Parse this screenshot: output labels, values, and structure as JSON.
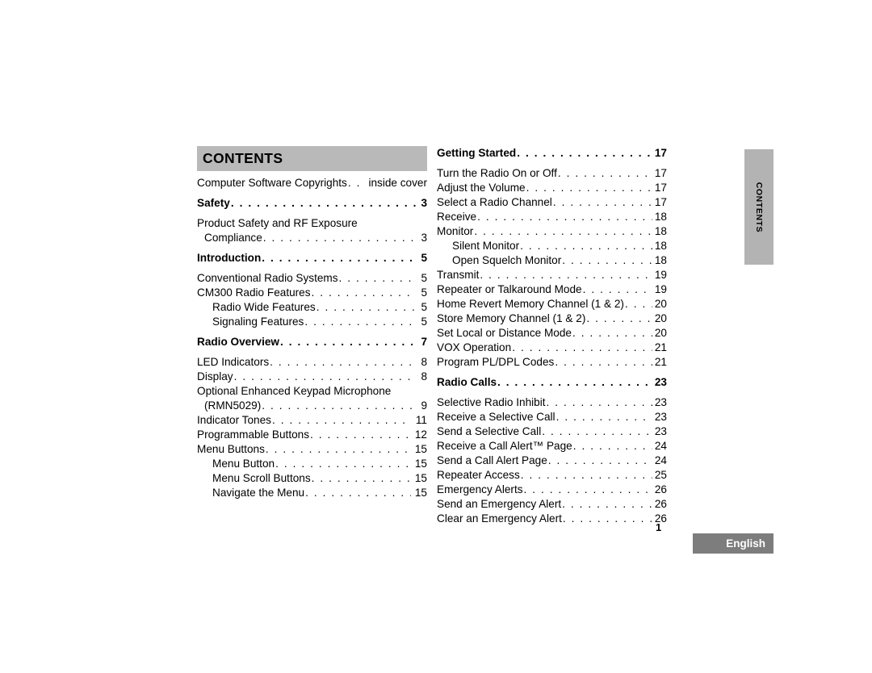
{
  "header": {
    "title": "CONTENTS"
  },
  "side_tab": {
    "label": "CONTENTS",
    "color": "#b3b3b3"
  },
  "footer": {
    "page_number": "1",
    "language_badge": "English",
    "badge_color": "#7d7d7d",
    "badge_text_color": "#ffffff"
  },
  "left_column": {
    "entries": [
      {
        "label": "Computer Software Copyrights",
        "page": "inside cover",
        "bold": false,
        "indent": 0,
        "leader": true
      },
      {
        "label": "Safety",
        "page": "3",
        "bold": true,
        "indent": 0,
        "leader": true,
        "gap_before": true,
        "gap_after": false
      },
      {
        "label": "Product Safety and RF Exposure",
        "page": "",
        "bold": false,
        "indent": 0,
        "leader": false
      },
      {
        "label": "Compliance",
        "page": "3",
        "bold": false,
        "indent": "cont",
        "leader": true
      },
      {
        "label": "Introduction",
        "page": "5",
        "bold": true,
        "indent": 0,
        "leader": true,
        "gap_before": true
      },
      {
        "label": "Conventional Radio Systems",
        "page": "5",
        "bold": false,
        "indent": 0,
        "leader": true
      },
      {
        "label": "CM300 Radio Features",
        "page": "5",
        "bold": false,
        "indent": 0,
        "leader": true
      },
      {
        "label": "Radio Wide Features",
        "page": "5",
        "bold": false,
        "indent": 1,
        "leader": true
      },
      {
        "label": "Signaling Features",
        "page": "5",
        "bold": false,
        "indent": 1,
        "leader": true
      },
      {
        "label": "Radio Overview",
        "page": "7",
        "bold": true,
        "indent": 0,
        "leader": true,
        "gap_before": true
      },
      {
        "label": "LED Indicators",
        "page": "8",
        "bold": false,
        "indent": 0,
        "leader": true
      },
      {
        "label": "Display",
        "page": "8",
        "bold": false,
        "indent": 0,
        "leader": true
      },
      {
        "label": "Optional Enhanced Keypad Microphone",
        "page": "",
        "bold": false,
        "indent": 0,
        "leader": false
      },
      {
        "label": "(RMN5029)",
        "page": "9",
        "bold": false,
        "indent": "cont",
        "leader": true
      },
      {
        "label": "Indicator Tones",
        "page": "11",
        "bold": false,
        "indent": 0,
        "leader": true
      },
      {
        "label": "Programmable Buttons",
        "page": "12",
        "bold": false,
        "indent": 0,
        "leader": true
      },
      {
        "label": "Menu Buttons",
        "page": "15",
        "bold": false,
        "indent": 0,
        "leader": true
      },
      {
        "label": "Menu Button",
        "page": "15",
        "bold": false,
        "indent": 1,
        "leader": true
      },
      {
        "label": "Menu Scroll Buttons",
        "page": "15",
        "bold": false,
        "indent": 1,
        "leader": true
      },
      {
        "label": "Navigate the Menu",
        "page": "15",
        "bold": false,
        "indent": 1,
        "leader": true
      }
    ]
  },
  "right_column": {
    "entries": [
      {
        "label": "Getting Started",
        "page": "17",
        "bold": true,
        "indent": 0,
        "leader": true
      },
      {
        "label": "Turn the Radio On or Off",
        "page": "17",
        "bold": false,
        "indent": 0,
        "leader": true
      },
      {
        "label": "Adjust the Volume",
        "page": "17",
        "bold": false,
        "indent": 0,
        "leader": true
      },
      {
        "label": "Select a Radio Channel",
        "page": "17",
        "bold": false,
        "indent": 0,
        "leader": true
      },
      {
        "label": "Receive",
        "page": "18",
        "bold": false,
        "indent": 0,
        "leader": true
      },
      {
        "label": "Monitor",
        "page": "18",
        "bold": false,
        "indent": 0,
        "leader": true
      },
      {
        "label": "Silent Monitor",
        "page": "18",
        "bold": false,
        "indent": 1,
        "leader": true
      },
      {
        "label": "Open Squelch Monitor",
        "page": "18",
        "bold": false,
        "indent": 1,
        "leader": true
      },
      {
        "label": "Transmit",
        "page": "19",
        "bold": false,
        "indent": 0,
        "leader": true
      },
      {
        "label": "Repeater or Talkaround Mode",
        "page": "19",
        "bold": false,
        "indent": 0,
        "leader": true
      },
      {
        "label": "Home Revert Memory Channel (1 & 2)",
        "page": "20",
        "bold": false,
        "indent": 0,
        "leader": true
      },
      {
        "label": "Store Memory Channel (1 & 2)",
        "page": "20",
        "bold": false,
        "indent": 0,
        "leader": true
      },
      {
        "label": "Set Local or Distance Mode",
        "page": "20",
        "bold": false,
        "indent": 0,
        "leader": true
      },
      {
        "label": "VOX Operation",
        "page": "21",
        "bold": false,
        "indent": 0,
        "leader": true
      },
      {
        "label": "Program PL/DPL Codes",
        "page": "21",
        "bold": false,
        "indent": 0,
        "leader": true
      },
      {
        "label": "Radio Calls",
        "page": "23",
        "bold": true,
        "indent": 0,
        "leader": true,
        "gap_before": true
      },
      {
        "label": "Selective Radio Inhibit",
        "page": "23",
        "bold": false,
        "indent": 0,
        "leader": true
      },
      {
        "label": "Receive a Selective Call",
        "page": "23",
        "bold": false,
        "indent": 0,
        "leader": true
      },
      {
        "label": "Send a Selective Call",
        "page": "23",
        "bold": false,
        "indent": 0,
        "leader": true
      },
      {
        "label": "Receive a Call Alert™ Page",
        "page": "24",
        "bold": false,
        "indent": 0,
        "leader": true
      },
      {
        "label": "Send a Call Alert Page",
        "page": "24",
        "bold": false,
        "indent": 0,
        "leader": true
      },
      {
        "label": "Repeater Access",
        "page": "25",
        "bold": false,
        "indent": 0,
        "leader": true
      },
      {
        "label": "Emergency Alerts",
        "page": "26",
        "bold": false,
        "indent": 0,
        "leader": true
      },
      {
        "label": "Send an Emergency Alert",
        "page": "26",
        "bold": false,
        "indent": 0,
        "leader": true
      },
      {
        "label": "Clear an Emergency Alert",
        "page": "26",
        "bold": false,
        "indent": 0,
        "leader": true
      }
    ]
  }
}
